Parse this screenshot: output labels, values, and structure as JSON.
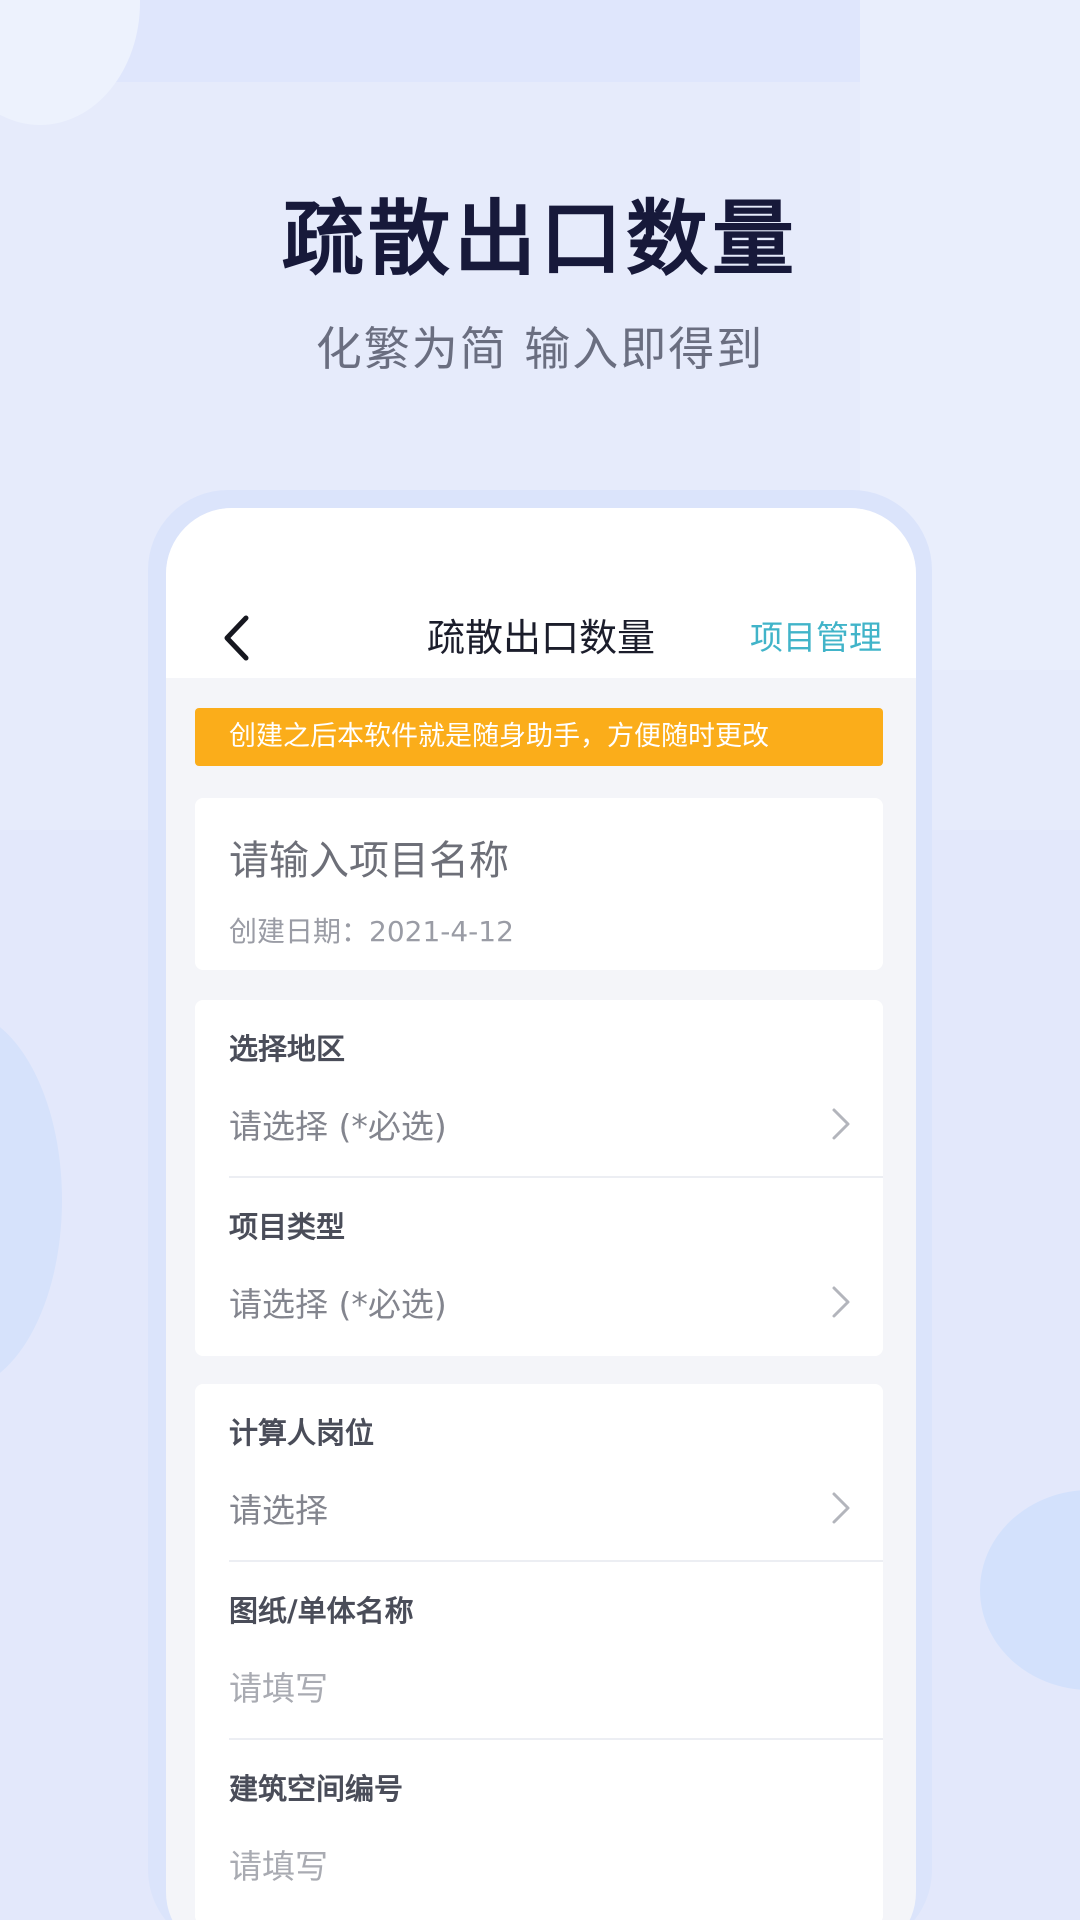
{
  "hero": {
    "title": "疏散出口数量",
    "subtitle": "化繁为简 输入即得到"
  },
  "nav": {
    "back_icon": "chevron-left-icon",
    "title": "疏散出口数量",
    "action": "项目管理",
    "action_color": "#41b4c9"
  },
  "notice": {
    "text": "创建之后本软件就是随身助手，方便随时更改",
    "color": "#fbad1a"
  },
  "project": {
    "name_placeholder": "请输入项目名称",
    "create_date": "创建日期：2021-4-12"
  },
  "fields": [
    {
      "label": "选择地区",
      "value": "请选择 (*必选)",
      "icon": "chevron-right-icon"
    },
    {
      "label": "项目类型",
      "value": "请选择 (*必选)",
      "icon": "chevron-right-icon"
    },
    {
      "label": "计算人岗位",
      "value": "请选择",
      "icon": "chevron-right-icon"
    },
    {
      "label": "图纸/单体名称",
      "value": "请填写"
    },
    {
      "label": "建筑空间编号",
      "value": "请填写"
    }
  ]
}
